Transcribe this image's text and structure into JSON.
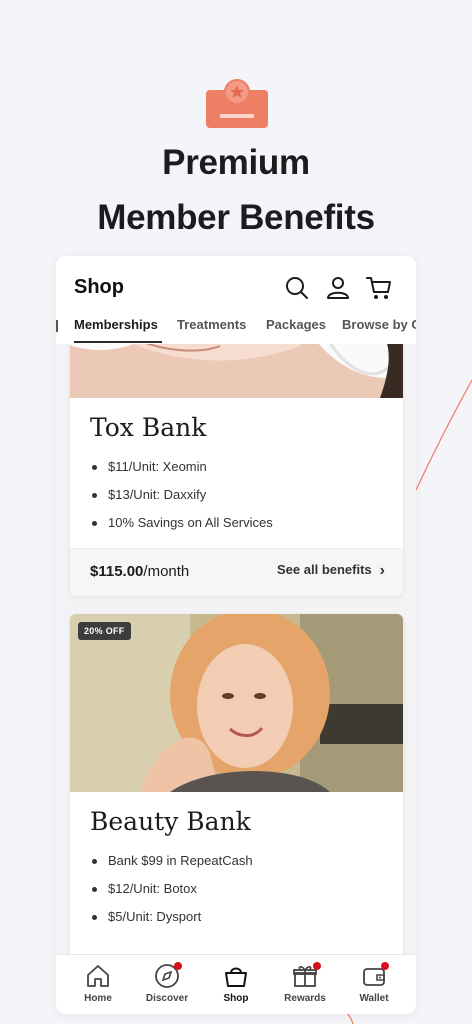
{
  "promo": {
    "icon": "membership-card-icon",
    "headline_line1": "Premium",
    "headline_line2": "Member Benefits",
    "accent_color": "#ee7e64"
  },
  "header": {
    "title": "Shop",
    "icons": [
      "search-icon",
      "user-icon",
      "cart-icon"
    ]
  },
  "tabs": [
    {
      "label": "Memberships",
      "active": true
    },
    {
      "label": "Treatments",
      "active": false
    },
    {
      "label": "Packages",
      "active": false
    },
    {
      "label": "Browse by C",
      "active": false
    }
  ],
  "memberships": [
    {
      "title": "Tox Bank",
      "benefits": [
        "$11/Unit: Xeomin",
        "$13/Unit: Daxxify",
        "10% Savings on All Services"
      ],
      "price": "$115.00",
      "price_period": "/month",
      "cta": "See all benefits"
    },
    {
      "badge": "20% OFF",
      "title": "Beauty Bank",
      "benefits": [
        "Bank $99 in RepeatCash",
        "$12/Unit: Botox",
        "$5/Unit: Dysport"
      ]
    }
  ],
  "bottom_nav": [
    {
      "label": "Home",
      "icon": "home-icon",
      "active": false,
      "dot": false
    },
    {
      "label": "Discover",
      "icon": "compass-icon",
      "active": false,
      "dot": true
    },
    {
      "label": "Shop",
      "icon": "shopping-bag-icon",
      "active": true,
      "dot": false
    },
    {
      "label": "Rewards",
      "icon": "gift-icon",
      "active": false,
      "dot": true
    },
    {
      "label": "Wallet",
      "icon": "wallet-icon",
      "active": false,
      "dot": true
    }
  ],
  "colors": {
    "notification_dot": "#d4121f",
    "background": "#f4f5f8"
  }
}
